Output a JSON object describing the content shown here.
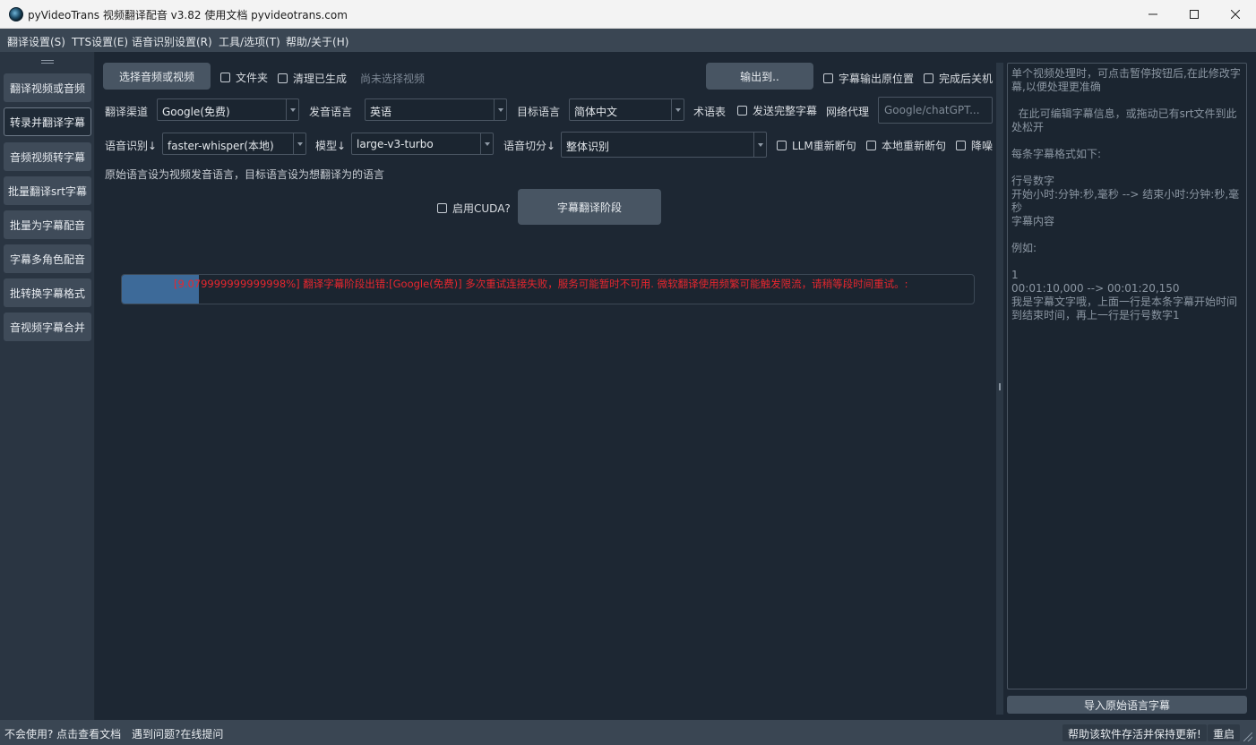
{
  "window": {
    "title": "pyVideoTrans 视频翻译配音 v3.82 使用文档 pyvideotrans.com"
  },
  "menu": {
    "items": [
      "翻译设置(S)",
      "TTS设置(E)",
      "语音识别设置(R)",
      "工具/选项(T)",
      "帮助/关于(H)"
    ]
  },
  "sidebar": {
    "items": [
      {
        "label": "翻译视频或音频"
      },
      {
        "label": "转录并翻译字幕"
      },
      {
        "label": "音频视频转字幕"
      },
      {
        "label": "批量翻译srt字幕"
      },
      {
        "label": "批量为字幕配音"
      },
      {
        "label": "字幕多角色配音"
      },
      {
        "label": "批转换字幕格式"
      },
      {
        "label": "音视频字幕合并"
      }
    ],
    "active_index": 1
  },
  "toolbar": {
    "select_label": "选择音频或视频",
    "folder_label": "文件夹",
    "clear_label": "清理已生成",
    "status_text": "尚未选择视频",
    "output_label": "输出到..",
    "keep_position_label": "字幕输出原位置",
    "shutdown_label": "完成后关机"
  },
  "translate_row": {
    "channel_label": "翻译渠道",
    "channel_value": "Google(免费)",
    "source_lang_label": "发音语言",
    "source_lang_value": "英语",
    "target_lang_label": "目标语言",
    "target_lang_value": "简体中文",
    "glossary_label": "术语表",
    "send_full_label": "发送完整字幕",
    "proxy_label": "网络代理",
    "proxy_placeholder": "Google/chatGPT..."
  },
  "asr_row": {
    "asr_label": "语音识别↓",
    "asr_value": "faster-whisper(本地)",
    "model_label": "模型↓",
    "model_value": "large-v3-turbo",
    "split_label": "语音切分↓",
    "split_value": "整体识别",
    "llm_resplit_label": "LLM重新断句",
    "local_resplit_label": "本地重新断句",
    "denoise_label": "降噪"
  },
  "hint": "原始语言设为视频发音语言，目标语言设为想翻译为的语言",
  "cuda_label": "启用CUDA?",
  "stage_button": "字幕翻译阶段",
  "progress": {
    "value": 0.09,
    "message": "[9.079999999999998%]  翻译字幕阶段出错:[Google(免费)] 多次重试连接失败，服务可能暂时不可用. 微软翻译使用频繁可能触发限流，请稍等段时间重试。:"
  },
  "editor": {
    "lines": [
      "单个视频处理时，可点击暂停按钮后,在此修改字幕,以便处理更准确",
      "",
      "  在此可编辑字幕信息，或拖动已有srt文件到此处松开",
      "",
      "每条字幕格式如下:",
      "",
      "行号数字",
      "开始小时:分钟:秒,毫秒 --> 结束小时:分钟:秒,毫秒",
      "字幕内容",
      "",
      "例如:",
      "",
      "1",
      "00:01:10,000 --> 00:01:20,150",
      "我是字幕文字哦，上面一行是本条字幕开始时间到结束时间，再上一行是行号数字1"
    ],
    "import_label": "导入原始语言字幕"
  },
  "status": {
    "help_text": "不会使用? 点击查看文档",
    "ask_text": "遇到问题?在线提问",
    "support_label": "帮助该软件存活并保持更新!",
    "restart_label": "重启"
  },
  "colors": {
    "error_text": "#e8262e",
    "progress_fill": "#3d6a99",
    "background": "#1d2733"
  },
  "icons": [
    "app-logo-icon",
    "minimize-icon",
    "maximize-icon",
    "close-icon",
    "chevron-down-icon"
  ]
}
